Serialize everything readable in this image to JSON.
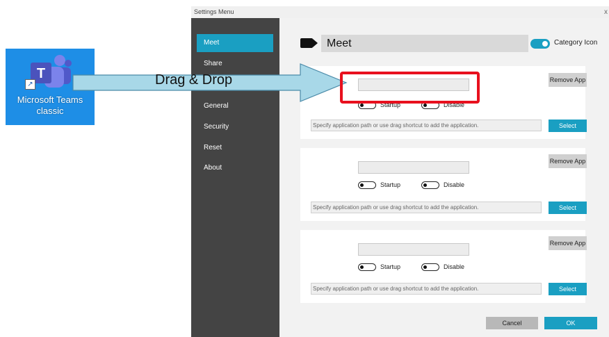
{
  "desktop_icon": {
    "label_line1": "Microsoft Teams",
    "label_line2": "classic",
    "icon": "teams-logo-icon",
    "shortcut_icon": "shortcut-arrow-icon",
    "logo_letter": "T"
  },
  "annotation": {
    "arrow_text": "Drag & Drop",
    "arrow_color": "#a8d8e8",
    "highlight_color": "#e8101e"
  },
  "window": {
    "title": "Settings Menu",
    "close_glyph": "x"
  },
  "sidebar": {
    "items": [
      {
        "label": "Meet",
        "active": true
      },
      {
        "label": "Share",
        "active": false
      },
      {
        "label": "General",
        "active": false
      },
      {
        "label": "Security",
        "active": false
      },
      {
        "label": "Reset",
        "active": false
      },
      {
        "label": "About",
        "active": false
      }
    ]
  },
  "header": {
    "category_name": "Meet",
    "category_icon": "video-camera-icon",
    "category_icon_toggle_label": "Category Icon",
    "category_icon_toggle_on": true
  },
  "apps": [
    {
      "name_value": "",
      "startup_label": "Startup",
      "disable_label": "Disable",
      "remove_label": "Remove App",
      "path_placeholder": "Specify application path or use drag shortcut to add the application.",
      "select_label": "Select"
    },
    {
      "name_value": "",
      "startup_label": "Startup",
      "disable_label": "Disable",
      "remove_label": "Remove App",
      "path_placeholder": "Specify application path or use drag shortcut to add the application.",
      "select_label": "Select"
    },
    {
      "name_value": "",
      "startup_label": "Startup",
      "disable_label": "Disable",
      "remove_label": "Remove App",
      "path_placeholder": "Specify application path or use drag shortcut to add the application.",
      "select_label": "Select"
    }
  ],
  "footer": {
    "cancel_label": "Cancel",
    "ok_label": "OK"
  },
  "colors": {
    "accent": "#1a9fc2",
    "sidebar_bg": "#444444",
    "desktop_icon_bg": "#1e8ee6"
  }
}
